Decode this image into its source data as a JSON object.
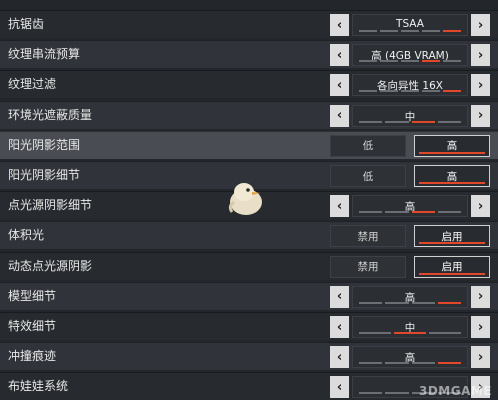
{
  "settings": [
    {
      "label": "抗锯齿",
      "type": "selector",
      "value": "TSAA",
      "level": 5,
      "levels": 5
    },
    {
      "label": "纹理串流预算",
      "type": "selector",
      "value": "高 (4GB VRAM)",
      "level": 4,
      "levels": 5
    },
    {
      "label": "纹理过滤",
      "type": "selector",
      "value": "各向异性 16X",
      "level": 5,
      "levels": 5
    },
    {
      "label": "环境光遮蔽质量",
      "type": "selector",
      "value": "中",
      "level": 3,
      "levels": 4
    },
    {
      "label": "阳光阴影范围",
      "type": "toggle",
      "options": [
        "低",
        "高"
      ],
      "selected": 1
    },
    {
      "label": "阳光阴影细节",
      "type": "toggle",
      "options": [
        "低",
        "高"
      ],
      "selected": 1
    },
    {
      "label": "点光源阴影细节",
      "type": "selector",
      "value": "高",
      "level": 3,
      "levels": 4
    },
    {
      "label": "体积光",
      "type": "toggle",
      "options": [
        "禁用",
        "启用"
      ],
      "selected": 1
    },
    {
      "label": "动态点光源阴影",
      "type": "toggle",
      "options": [
        "禁用",
        "启用"
      ],
      "selected": 1
    },
    {
      "label": "模型细节",
      "type": "selector",
      "value": "高",
      "level": 4,
      "levels": 4
    },
    {
      "label": "特效细节",
      "type": "selector",
      "value": "中",
      "level": 2,
      "levels": 3
    },
    {
      "label": "冲撞痕迹",
      "type": "selector",
      "value": "高",
      "level": 4,
      "levels": 4
    },
    {
      "label": "布娃娃系统",
      "type": "selector",
      "value": "",
      "level": 0,
      "levels": 4
    }
  ],
  "icons": {
    "left": "chevron-left-icon",
    "right": "chevron-right-icon",
    "mascot": "bird-mascot-icon"
  },
  "colors": {
    "accent": "#e0472b"
  },
  "watermark": "3DMGAME"
}
